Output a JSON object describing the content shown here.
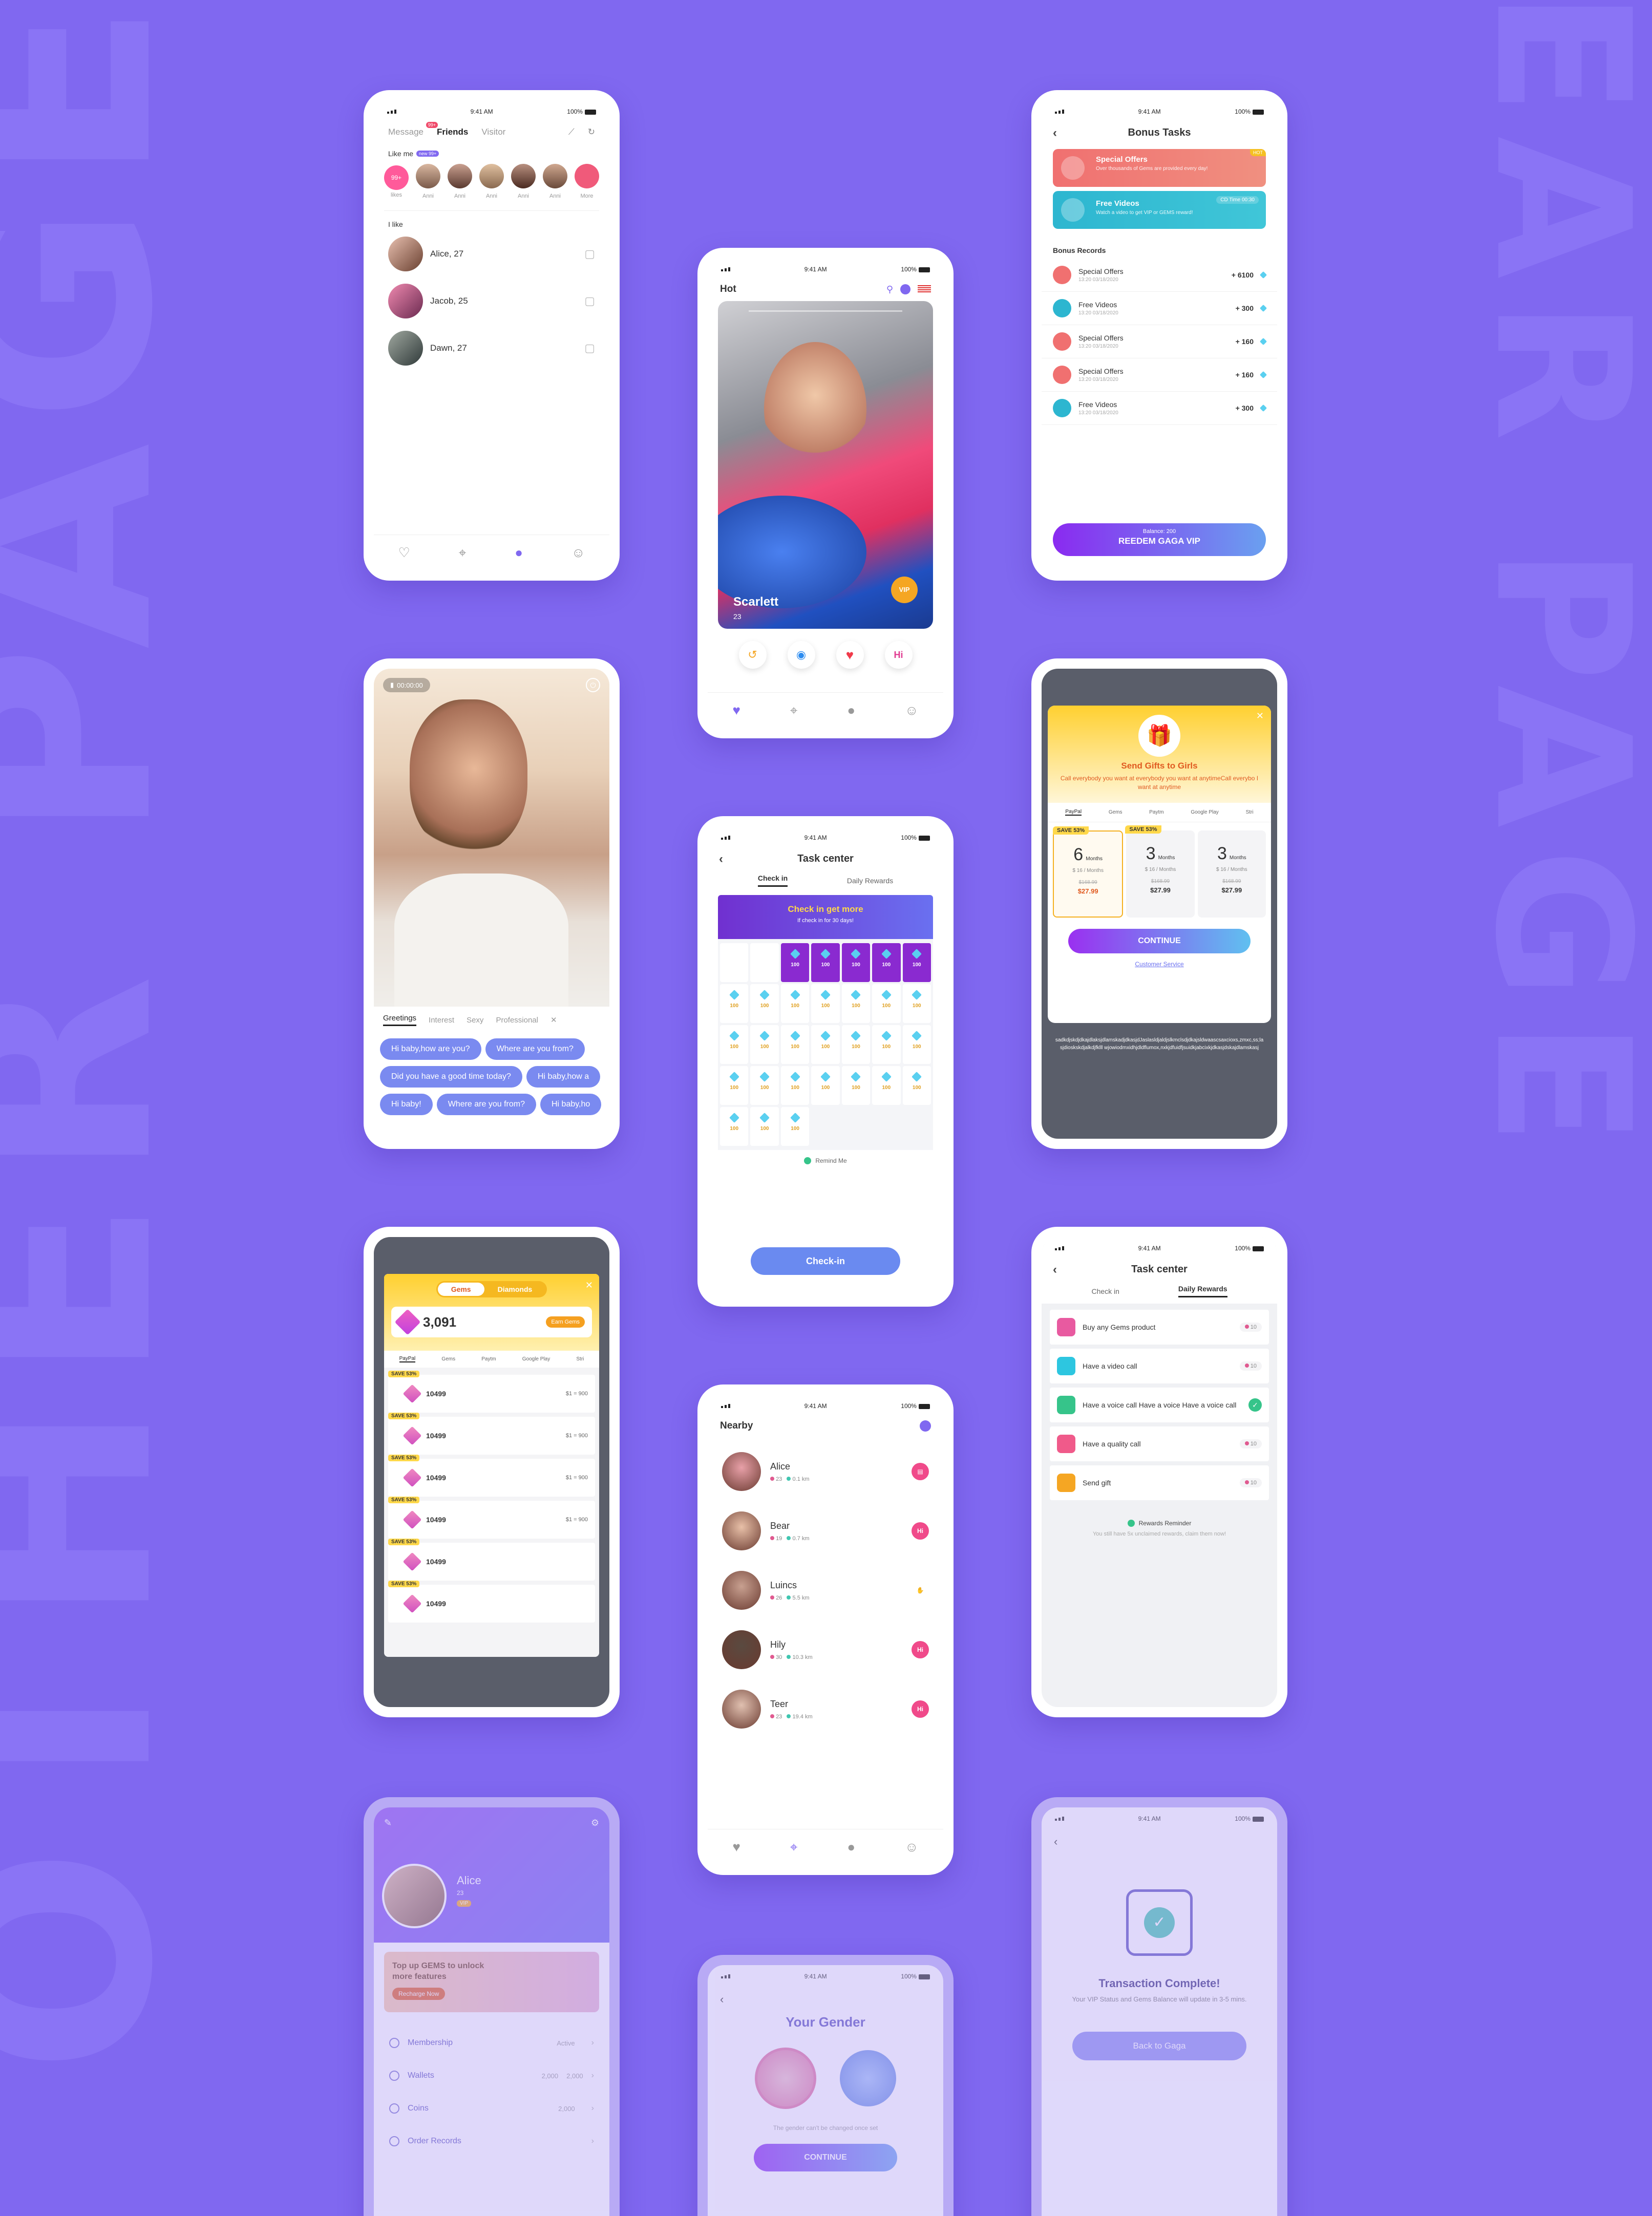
{
  "bg_words": {
    "left": "OTHER PAGE",
    "right": "EAR PAGE"
  },
  "status": {
    "time": "9:41 AM",
    "battery": "100%"
  },
  "messages": {
    "tabs": [
      "Message",
      "Friends",
      "Visitor"
    ],
    "message_badge": "99+",
    "like_me_label": "Like me",
    "like_me_badge": "new 99+",
    "like_me_names": [
      "likes",
      "Anni",
      "Anni",
      "Anni",
      "Anni",
      "Anni",
      "More"
    ],
    "like_me_first_count": "99+",
    "i_like_label": "I like",
    "contacts": [
      "Alice, 27",
      "Jacob, 25",
      "Dawn, 27"
    ]
  },
  "hot": {
    "title": "Hot",
    "name": "Scarlett",
    "age": "23",
    "vip": "VIP"
  },
  "bonus": {
    "title": "Bonus Tasks",
    "offer_title": "Special Offers",
    "offer_sub": "Over thousands of Gems are provided every day!",
    "offer_tag": "HOT",
    "video_title": "Free Videos",
    "video_sub": "Watch a video to get VIP or GEMS reward!",
    "video_tag": "CD Time 00:30",
    "records_label": "Bonus Records",
    "records": [
      {
        "title": "Special Offers",
        "time": "13:20 03/18/2020",
        "amount": "+ 6100"
      },
      {
        "title": "Free Videos",
        "time": "13:20 03/18/2020",
        "amount": "+ 300"
      },
      {
        "title": "Special Offers",
        "time": "13:20 03/18/2020",
        "amount": "+ 160"
      },
      {
        "title": "Special Offers",
        "time": "13:20 03/18/2020",
        "amount": "+ 160"
      },
      {
        "title": "Free Videos",
        "time": "13:20 03/18/2020",
        "amount": "+ 300"
      }
    ],
    "balance": "Balance: 200",
    "redeem": "REEDEM GAGA VIP"
  },
  "call": {
    "timer": "00:00:00",
    "tabs": [
      "Greetings",
      "Interest",
      "Sexy",
      "Professional"
    ],
    "chips": [
      [
        "Hi baby,how are you?",
        "Where are you from?"
      ],
      [
        "Did you have a good time today?",
        "Hi baby,how a"
      ],
      [
        "Hi baby!",
        "Where are you from?",
        "Hi baby,ho"
      ]
    ]
  },
  "checkin": {
    "title": "Task center",
    "tabs": [
      "Check in",
      "Daily Rewards"
    ],
    "banner_title": "Check in get more",
    "banner_sub": "If check in for 30 days!",
    "reward": "100",
    "remind": "Remind Me",
    "button": "Check-in"
  },
  "gifts": {
    "title": "Send Gifts to Girls",
    "desc": "Call everybody you want at everybody you want at anytimeCall everybo I want at anytime",
    "pay": [
      "PayPal",
      "Gems",
      "Paytm",
      "Google Play",
      "Stri"
    ],
    "plans": [
      {
        "save": "SAVE 53%",
        "n": "6",
        "unit": "Months",
        "per": "$ 16 / Months",
        "old": "$168.99",
        "price": "$27.99"
      },
      {
        "save": "SAVE 53%",
        "n": "3",
        "unit": "Months",
        "per": "$ 16 / Months",
        "old": "$168.99",
        "price": "$27.99"
      },
      {
        "save": "",
        "n": "3",
        "unit": "Months",
        "per": "$ 16 / Months",
        "old": "$168.99",
        "price": "$27.99"
      }
    ],
    "continue": "CONTINUE",
    "service": "Customer Service",
    "footer": "sadkdjskdjdkajdlaksjdlamskadjdkasjdJaslasldjaldjslkmclsdjdkajsldwaascsaxcioxs,zmxc,ss;lasjdioskskdjalkdjfklll wjowiodmxidhjdldflumox,nxkjdfuidfjsuidkjabcixkjdkasjdskajdlamskasj"
  },
  "wallet": {
    "tabs": [
      "Gems",
      "Diamonds"
    ],
    "balance": "3,091",
    "earn": "Earn Gems",
    "pay": [
      "PayPal",
      "Gems",
      "Paytm",
      "Google Play",
      "Stri"
    ],
    "items": [
      {
        "save": "SAVE 53%",
        "amount": "10499",
        "price": "$1 = 900"
      },
      {
        "save": "SAVE 53%",
        "amount": "10499",
        "price": "$1 = 900"
      },
      {
        "save": "SAVE 53%",
        "amount": "10499",
        "price": "$1 = 900"
      },
      {
        "save": "SAVE 53%",
        "amount": "10499",
        "price": "$1 = 900"
      },
      {
        "save": "SAVE 53%",
        "amount": "10499",
        "price": ""
      },
      {
        "save": "SAVE 53%",
        "amount": "10499",
        "price": ""
      }
    ]
  },
  "nearby": {
    "title": "Nearby",
    "people": [
      {
        "name": "Alice",
        "age": "23",
        "dist": "0.1 km",
        "action": "chat"
      },
      {
        "name": "Bear",
        "age": "19",
        "dist": "0.7 km",
        "action": "Hi"
      },
      {
        "name": "Luincs",
        "age": "26",
        "dist": "5.5 km",
        "action": "hand"
      },
      {
        "name": "Hily",
        "age": "30",
        "dist": "10.3 km",
        "action": "Hi"
      },
      {
        "name": "Teer",
        "age": "23",
        "dist": "19.4 km",
        "action": "Hi"
      }
    ]
  },
  "daily": {
    "title": "Task center",
    "tabs": [
      "Check in",
      "Daily Rewards"
    ],
    "tasks": [
      {
        "label": "Buy any Gems product",
        "reward": "10",
        "color": "#e85aa0"
      },
      {
        "label": "Have a video call",
        "reward": "10",
        "color": "#2dc6e0"
      },
      {
        "label": "Have a voice call Have a voice  Have a voice call",
        "reward": "",
        "color": "#36c48a"
      },
      {
        "label": "Have a quality call",
        "reward": "10",
        "color": "#f05a8a"
      },
      {
        "label": "Send gift",
        "reward": "10",
        "color": "#f5a623"
      }
    ],
    "reminder": "Rewards Reminder",
    "reminder_sub": "You still have 5x unclaimed rewards, claim them now!"
  },
  "profile": {
    "name": "Alice",
    "age": "23",
    "vip": "VIP",
    "banner": "Top up GEMS to unlock more features",
    "recharge": "Recharge Now",
    "menu": [
      {
        "label": "Membership",
        "value": "Active",
        "value2": ""
      },
      {
        "label": "Wallets",
        "value": "2,000",
        "value2": "2,000"
      },
      {
        "label": "Coins",
        "value": "2,000",
        "value2": ""
      },
      {
        "label": "Order Records",
        "value": "",
        "value2": ""
      }
    ]
  },
  "gender": {
    "title": "Your Gender",
    "note": "The gender can't be changed once set",
    "button": "CONTINUE"
  },
  "transaction": {
    "title": "Transaction Complete!",
    "sub": "Your VIP Status and Gems Balance will update in 3-5 mins.",
    "button": "Back to Gaga"
  }
}
